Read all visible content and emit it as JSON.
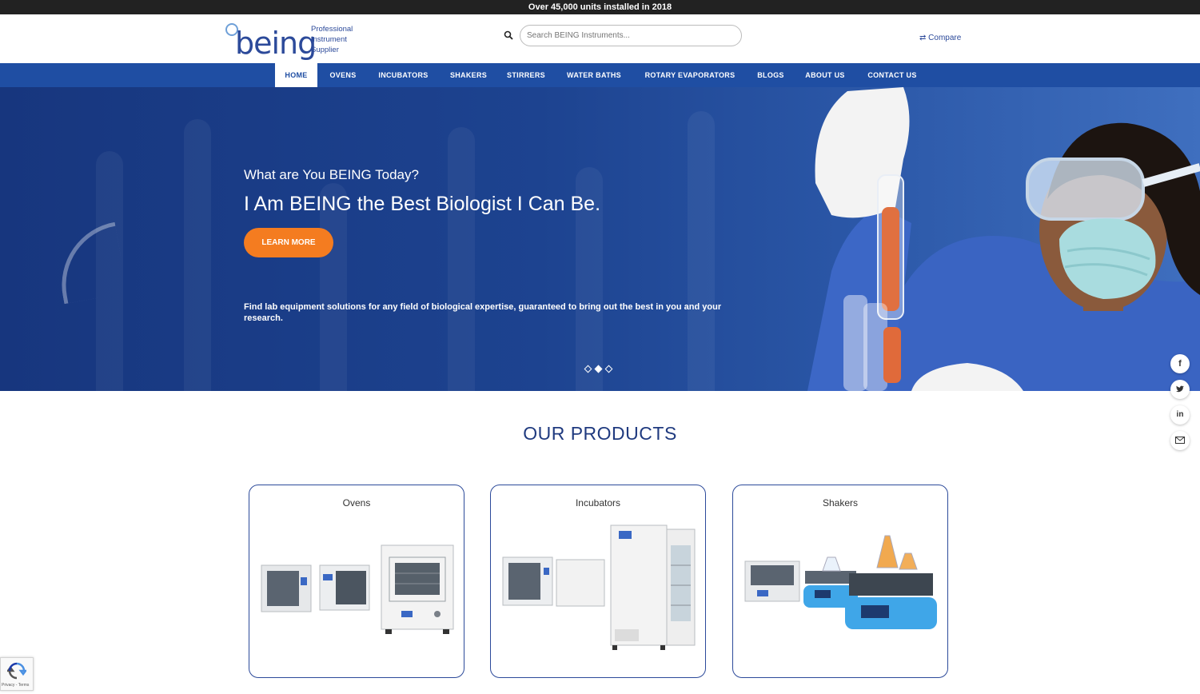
{
  "topbar": {
    "message": "Over 45,000 units installed in 2018"
  },
  "header": {
    "logo_word": "being",
    "logo_tagline": [
      "Professional",
      "Instrument",
      "Supplier"
    ],
    "search_placeholder": "Search BEING Instruments...",
    "compare_label": "Compare"
  },
  "nav": {
    "items": [
      {
        "label": "HOME",
        "active": true
      },
      {
        "label": "OVENS"
      },
      {
        "label": "INCUBATORS"
      },
      {
        "label": "SHAKERS"
      },
      {
        "label": "STIRRERS"
      },
      {
        "label": "WATER BATHS"
      },
      {
        "label": "ROTARY EVAPORATORS"
      },
      {
        "label": "BLOGS"
      },
      {
        "label": "ABOUT US"
      },
      {
        "label": "CONTACT US"
      }
    ]
  },
  "hero": {
    "kicker": "What are You BEING Today?",
    "title": "I Am BEING the Best Biologist I Can Be.",
    "button_label": "LEARN MORE",
    "description": "Find lab equipment solutions for any field of biological expertise, guaranteed to bring out the best in you and your research.",
    "slides": {
      "count": 3,
      "active_index": 1
    }
  },
  "products": {
    "heading": "OUR PRODUCTS",
    "cards": [
      {
        "title": "Ovens"
      },
      {
        "title": "Incubators"
      },
      {
        "title": "Shakers"
      }
    ]
  },
  "social": {
    "icons": [
      "facebook-icon",
      "twitter-icon",
      "linkedin-icon",
      "mail-icon"
    ]
  },
  "recaptcha": {
    "text": "Privacy - Terms"
  },
  "colors": {
    "brand_blue": "#1f4ea3",
    "accent_orange": "#f47c20",
    "topbar_bg": "#222222"
  }
}
